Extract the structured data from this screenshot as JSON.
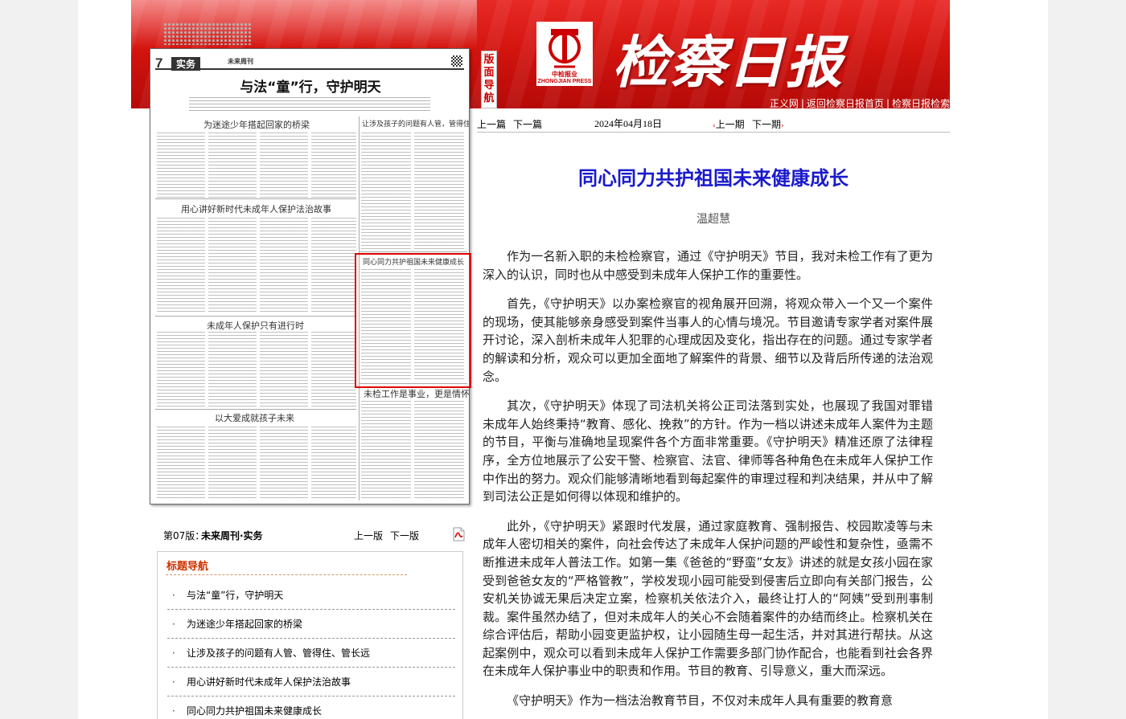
{
  "header": {
    "masthead": "检察日报",
    "logo_cn": "中检报业",
    "logo_en": "ZHONGJIAN PRESS",
    "links": [
      "正义网",
      "返回检察日报首页",
      "检察日报检索"
    ]
  },
  "version_strip": [
    "版",
    "面",
    "导",
    "航"
  ],
  "page_thumb": {
    "page_number": "7",
    "section": "实务",
    "column": "未来周刊",
    "title": "与法“童”行，守护明天",
    "subheads": [
      "为迷途少年搭起回家的桥梁",
      "让涉及孩子的问题有人管，管得住，管长远",
      "用心讲好新时代未成年人保护法治故事",
      "同心同力共护祖国未来健康成长",
      "未成年人保护只有进行时",
      "未检工作是事业，更是情怀",
      "以大爱成就孩子未来"
    ]
  },
  "page_nav": {
    "label": "第07版：",
    "name": "未来周刊·实务",
    "prev": "上一版",
    "next": "下一版",
    "pdf_icon": "pdf-icon"
  },
  "headline_nav": {
    "title": "标题导航",
    "bullet": "·",
    "items": [
      "与法“童”行，守护明天",
      "为迷途少年搭起回家的桥梁",
      "让涉及孩子的问题有人管、管得住、管长远",
      "用心讲好新时代未成年人保护法治故事",
      "同心同力共护祖国未来健康成长"
    ]
  },
  "article_nav": {
    "prev_article": "上一篇",
    "next_article": "下一篇",
    "date": "2024年04月18日",
    "prev_issue": "上一期",
    "next_issue": "下一期"
  },
  "article": {
    "title": "同心同力共护祖国未来健康成长",
    "author": "温超慧",
    "paragraphs": [
      "作为一名新入职的未检检察官，通过《守护明天》节目，我对未检工作有了更为深入的认识，同时也从中感受到未成年人保护工作的重要性。",
      "首先，《守护明天》以办案检察官的视角展开回溯，将观众带入一个又一个案件的现场，使其能够亲身感受到案件当事人的心情与境况。节目邀请专家学者对案件展开讨论，深入剖析未成年人犯罪的心理成因及变化，指出存在的问题。通过专家学者的解读和分析，观众可以更加全面地了解案件的背景、细节以及背后所传递的法治观念。",
      "其次，《守护明天》体现了司法机关将公正司法落到实处，也展现了我国对罪错未成年人始终秉持“教育、感化、挽救”的方针。作为一档以讲述未成年人案件为主题的节目，平衡与准确地呈现案件各个方面非常重要。《守护明天》精准还原了法律程序，全方位地展示了公安干警、检察官、法官、律师等各种角色在未成年人保护工作中作出的努力。观众们能够清晰地看到每起案件的审理过程和判决结果，并从中了解到司法公正是如何得以体现和维护的。",
      "此外，《守护明天》紧跟时代发展，通过家庭教育、强制报告、校园欺凌等与未成年人密切相关的案件，向社会传达了未成年人保护问题的严峻性和复杂性，亟需不断推进未成年人普法工作。如第一集《爸爸的“野蛮”女友》讲述的就是女孩小园在家受到爸爸女友的“严格管教”，学校发现小园可能受到侵害后立即向有关部门报告，公安机关协诚无果后决定立案，检察机关依法介入，最终让打人的“阿姨”受到刑事制裁。案件虽然办结了，但对未成年人的关心不会随着案件的办结而终止。检察机关在综合评估后，帮助小园变更监护权，让小园随生母一起生活，并对其进行帮扶。从这起案例中，观众可以看到未成年人保护工作需要多部门协作配合，也能看到社会各界在未成年人保护事业中的职责和作用。节目的教育、引导意义，重大而深远。",
      "《守护明天》作为一档法治教育节目，不仅对未成年人具有重要的教育意"
    ]
  },
  "colors": {
    "banner_red": "#d3140f",
    "title_blue": "#1a1acc",
    "panel_title": "#cc3300",
    "highlight_box": "#dd0000"
  }
}
